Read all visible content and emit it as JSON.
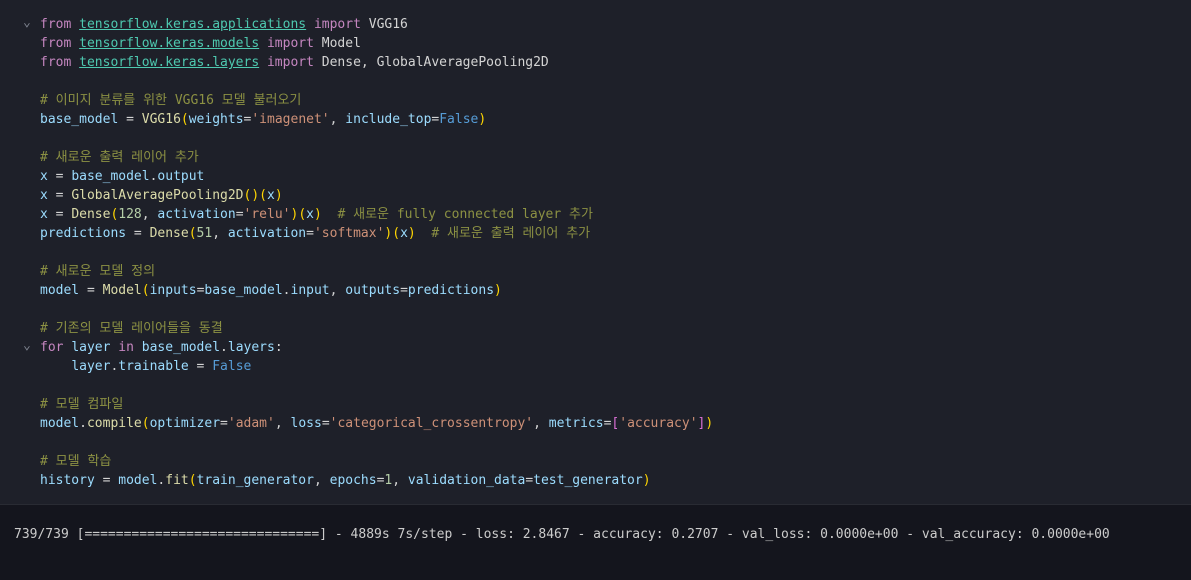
{
  "colors": {
    "keyword": "#C586C0",
    "module": "#4EC9B0",
    "variable": "#9CDCFE",
    "function": "#DCDCAA",
    "string": "#CE9178",
    "number": "#B5CEA8",
    "comment": "#8C9143",
    "constant": "#569CD6",
    "text": "#D4D4D4",
    "paren1": "#FFD602",
    "paren2": "#DA70D6",
    "cell_background": "#1e2029",
    "page_background": "#14151d"
  },
  "code": {
    "lines": [
      {
        "fold": true,
        "tokens": [
          [
            "from ",
            "keyword"
          ],
          [
            "tensorflow.keras.applications",
            "module"
          ],
          [
            " ",
            "text"
          ],
          [
            "import",
            "keyword"
          ],
          [
            " VGG16",
            "text"
          ]
        ]
      },
      {
        "tokens": [
          [
            "from ",
            "keyword"
          ],
          [
            "tensorflow.keras.models",
            "module"
          ],
          [
            " ",
            "text"
          ],
          [
            "import",
            "keyword"
          ],
          [
            " Model",
            "text"
          ]
        ]
      },
      {
        "tokens": [
          [
            "from ",
            "keyword"
          ],
          [
            "tensorflow.keras.layers",
            "module"
          ],
          [
            " ",
            "text"
          ],
          [
            "import",
            "keyword"
          ],
          [
            " Dense, GlobalAveragePooling2D",
            "text"
          ]
        ]
      },
      {
        "tokens": []
      },
      {
        "tokens": [
          [
            "# 이미지 분류를 위한 VGG16 모델 불러오기",
            "comment"
          ]
        ]
      },
      {
        "tokens": [
          [
            "base_model",
            "variable"
          ],
          [
            " = ",
            "text"
          ],
          [
            "VGG16",
            "function"
          ],
          [
            "(",
            "paren1"
          ],
          [
            "weights",
            "variable"
          ],
          [
            "=",
            "text"
          ],
          [
            "'imagenet'",
            "string"
          ],
          [
            ", ",
            "text"
          ],
          [
            "include_top",
            "variable"
          ],
          [
            "=",
            "text"
          ],
          [
            "False",
            "constant"
          ],
          [
            ")",
            "paren1"
          ]
        ]
      },
      {
        "tokens": []
      },
      {
        "tokens": [
          [
            "# 새로운 출력 레이어 추가",
            "comment"
          ]
        ]
      },
      {
        "tokens": [
          [
            "x",
            "variable"
          ],
          [
            " = ",
            "text"
          ],
          [
            "base_model",
            "variable"
          ],
          [
            ".",
            "text"
          ],
          [
            "output",
            "variable"
          ]
        ]
      },
      {
        "tokens": [
          [
            "x",
            "variable"
          ],
          [
            " = ",
            "text"
          ],
          [
            "GlobalAveragePooling2D",
            "function"
          ],
          [
            "(",
            "paren1"
          ],
          [
            ")",
            "paren1"
          ],
          [
            "(",
            "paren1"
          ],
          [
            "x",
            "variable"
          ],
          [
            ")",
            "paren1"
          ]
        ]
      },
      {
        "tokens": [
          [
            "x",
            "variable"
          ],
          [
            " = ",
            "text"
          ],
          [
            "Dense",
            "function"
          ],
          [
            "(",
            "paren1"
          ],
          [
            "128",
            "number"
          ],
          [
            ", ",
            "text"
          ],
          [
            "activation",
            "variable"
          ],
          [
            "=",
            "text"
          ],
          [
            "'relu'",
            "string"
          ],
          [
            ")",
            "paren1"
          ],
          [
            "(",
            "paren1"
          ],
          [
            "x",
            "variable"
          ],
          [
            ")",
            "paren1"
          ],
          [
            "  ",
            "text"
          ],
          [
            "# 새로운 fully connected layer 추가",
            "comment"
          ]
        ]
      },
      {
        "tokens": [
          [
            "predictions",
            "variable"
          ],
          [
            " = ",
            "text"
          ],
          [
            "Dense",
            "function"
          ],
          [
            "(",
            "paren1"
          ],
          [
            "51",
            "number"
          ],
          [
            ", ",
            "text"
          ],
          [
            "activation",
            "variable"
          ],
          [
            "=",
            "text"
          ],
          [
            "'softmax'",
            "string"
          ],
          [
            ")",
            "paren1"
          ],
          [
            "(",
            "paren1"
          ],
          [
            "x",
            "variable"
          ],
          [
            ")",
            "paren1"
          ],
          [
            "  ",
            "text"
          ],
          [
            "# 새로운 출력 레이어 추가",
            "comment"
          ]
        ]
      },
      {
        "tokens": []
      },
      {
        "tokens": [
          [
            "# 새로운 모델 정의",
            "comment"
          ]
        ]
      },
      {
        "tokens": [
          [
            "model",
            "variable"
          ],
          [
            " = ",
            "text"
          ],
          [
            "Model",
            "function"
          ],
          [
            "(",
            "paren1"
          ],
          [
            "inputs",
            "variable"
          ],
          [
            "=",
            "text"
          ],
          [
            "base_model",
            "variable"
          ],
          [
            ".",
            "text"
          ],
          [
            "input",
            "variable"
          ],
          [
            ", ",
            "text"
          ],
          [
            "outputs",
            "variable"
          ],
          [
            "=",
            "text"
          ],
          [
            "predictions",
            "variable"
          ],
          [
            ")",
            "paren1"
          ]
        ]
      },
      {
        "tokens": []
      },
      {
        "tokens": [
          [
            "# 기존의 모델 레이어들을 동결",
            "comment"
          ]
        ]
      },
      {
        "fold": true,
        "tokens": [
          [
            "for",
            "keyword"
          ],
          [
            " ",
            "text"
          ],
          [
            "layer",
            "variable"
          ],
          [
            " ",
            "text"
          ],
          [
            "in",
            "keyword"
          ],
          [
            " ",
            "text"
          ],
          [
            "base_model",
            "variable"
          ],
          [
            ".",
            "text"
          ],
          [
            "layers",
            "variable"
          ],
          [
            ":",
            "text"
          ]
        ]
      },
      {
        "tokens": [
          [
            "    ",
            "text"
          ],
          [
            "layer",
            "variable"
          ],
          [
            ".",
            "text"
          ],
          [
            "trainable",
            "variable"
          ],
          [
            " = ",
            "text"
          ],
          [
            "False",
            "constant"
          ]
        ]
      },
      {
        "tokens": []
      },
      {
        "tokens": [
          [
            "# 모델 컴파일",
            "comment"
          ]
        ]
      },
      {
        "tokens": [
          [
            "model",
            "variable"
          ],
          [
            ".",
            "text"
          ],
          [
            "compile",
            "function"
          ],
          [
            "(",
            "paren1"
          ],
          [
            "optimizer",
            "variable"
          ],
          [
            "=",
            "text"
          ],
          [
            "'adam'",
            "string"
          ],
          [
            ", ",
            "text"
          ],
          [
            "loss",
            "variable"
          ],
          [
            "=",
            "text"
          ],
          [
            "'categorical_crossentropy'",
            "string"
          ],
          [
            ", ",
            "text"
          ],
          [
            "metrics",
            "variable"
          ],
          [
            "=",
            "text"
          ],
          [
            "[",
            "paren2"
          ],
          [
            "'accuracy'",
            "string"
          ],
          [
            "]",
            "paren2"
          ],
          [
            ")",
            "paren1"
          ]
        ]
      },
      {
        "tokens": []
      },
      {
        "tokens": [
          [
            "# 모델 학습",
            "comment"
          ]
        ]
      },
      {
        "tokens": [
          [
            "history",
            "variable"
          ],
          [
            " = ",
            "text"
          ],
          [
            "model",
            "variable"
          ],
          [
            ".",
            "text"
          ],
          [
            "fit",
            "function"
          ],
          [
            "(",
            "paren1"
          ],
          [
            "train_generator",
            "variable"
          ],
          [
            ", ",
            "text"
          ],
          [
            "epochs",
            "variable"
          ],
          [
            "=",
            "text"
          ],
          [
            "1",
            "number"
          ],
          [
            ", ",
            "text"
          ],
          [
            "validation_data",
            "variable"
          ],
          [
            "=",
            "text"
          ],
          [
            "test_generator",
            "variable"
          ],
          [
            ")",
            "paren1"
          ]
        ]
      }
    ]
  },
  "output": {
    "text": "739/739 [==============================] - 4889s 7s/step - loss: 2.8467 - accuracy: 0.2707 - val_loss: 0.0000e+00 - val_accuracy: 0.0000e+00"
  },
  "icons": {
    "fold_chevron": "⌄"
  }
}
